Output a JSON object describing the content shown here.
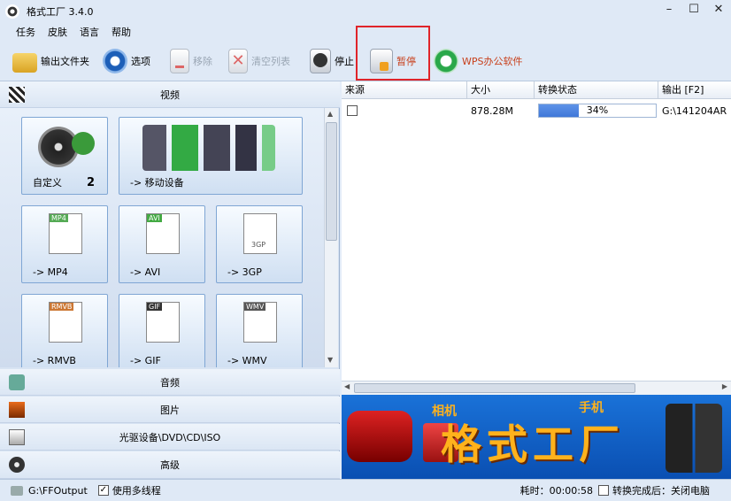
{
  "window": {
    "title": "格式工厂 3.4.0"
  },
  "menu": [
    "任务",
    "皮肤",
    "语言",
    "帮助"
  ],
  "toolbar": {
    "output_folder": "输出文件夹",
    "options": "选项",
    "remove": "移除",
    "clear_list": "清空列表",
    "stop": "停止",
    "pause": "暂停",
    "wps": "WPS办公软件"
  },
  "categories": {
    "video": "视频",
    "audio": "音频",
    "picture": "图片",
    "rom": "光驱设备\\DVD\\CD\\ISO",
    "advanced": "高级"
  },
  "tiles": {
    "custom": "自定义",
    "custom_count": "2",
    "mobile": "-> 移动设备",
    "mp4": "-> MP4",
    "avi": "-> AVI",
    "gp3": "-> 3GP",
    "rmvb": "-> RMVB",
    "gif": "-> GIF",
    "wmv": "-> WMV",
    "mp4_badge": "MP4",
    "avi_badge": "AVI",
    "gp3_badge": "3GP",
    "rmvb_badge": "RMVB",
    "gif_badge": "GIF",
    "wmv_badge": "WMV"
  },
  "grid": {
    "headers": [
      "来源",
      "大小",
      "转换状态",
      "输出 [F2]"
    ],
    "row": {
      "source": "",
      "size": "878.28M",
      "progress_label": "34%",
      "progress": 0.34,
      "output": "G:\\141204AR"
    }
  },
  "banner": {
    "title": "格式工厂",
    "tag1": "相机",
    "tag2": "手机"
  },
  "status": {
    "output_path": "G:\\FFOutput",
    "multithread": "使用多线程",
    "elapsed": "耗时：00:00:58",
    "after_done": "转换完成后：关闭电脑"
  },
  "colors": {
    "accent": "#3f77d8",
    "highlight": "#e0242a",
    "banner": "#0a4fb2",
    "banner_text": "#ffb21c"
  }
}
